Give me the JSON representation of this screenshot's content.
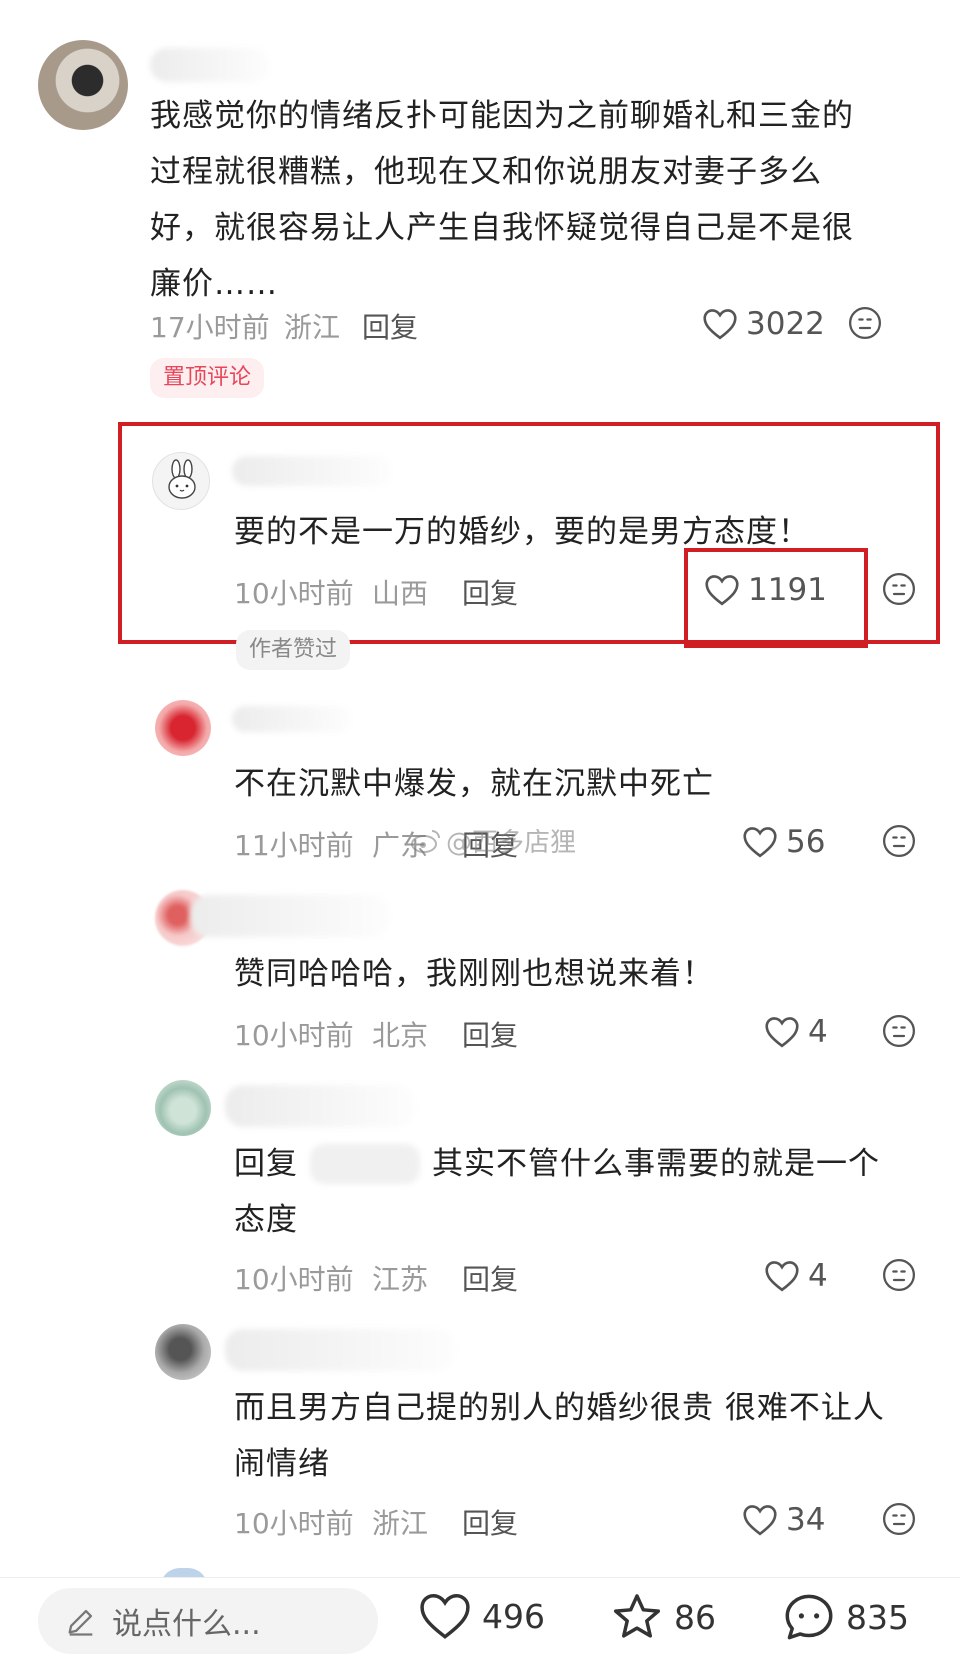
{
  "comments": [
    {
      "text_lines": [
        "我感觉你的情绪反扑可能因为之前聊婚礼和三金的",
        "过程就很糟糕，他现在又和你说朋友对妻子多么",
        "好，就很容易让人产生自我怀疑觉得自己是不是很",
        "廉价……"
      ],
      "time": "17小时前",
      "region": "浙江",
      "reply": "回复",
      "likes": "3022",
      "tag": "置顶评论"
    },
    {
      "text_lines": [
        "要的不是一万的婚纱，要的是男方态度！"
      ],
      "time": "10小时前",
      "region": "山西",
      "reply": "回复",
      "likes": "1191",
      "tag": "作者赞过"
    },
    {
      "text_lines": [
        "不在沉默中爆发，就在沉默中死亡"
      ],
      "time": "11小时前",
      "region": "广东",
      "reply": "回复",
      "likes": "56"
    },
    {
      "text_lines": [
        "赞同哈哈哈，我刚刚也想说来着！"
      ],
      "time": "10小时前",
      "region": "北京",
      "reply": "回复",
      "likes": "4"
    },
    {
      "text_prefix": "回复",
      "text_lines": [
        "其实不管什么事需要的就是一个",
        "态度"
      ],
      "time": "10小时前",
      "region": "江苏",
      "reply": "回复",
      "likes": "4"
    },
    {
      "text_lines": [
        "而且男方自己提的别人的婚纱很贵 很难不让人",
        "闹情绪"
      ],
      "time": "10小时前",
      "region": "浙江",
      "reply": "回复",
      "likes": "34"
    }
  ],
  "watermark": "@西多店狸",
  "bottom_bar": {
    "input_placeholder": "说点什么...",
    "likes": "496",
    "favorites": "86",
    "comments": "835"
  },
  "colors": {
    "highlight_box": "#cf1f25",
    "pinned_tag_text": "#e8465a",
    "pinned_tag_bg": "#fdeef0",
    "meta_text": "#9a9a9a"
  },
  "icons": [
    "heart-icon",
    "emoji-face-icon",
    "bunny-avatar-icon",
    "pencil-icon",
    "star-icon",
    "comment-bubble-icon",
    "weibo-logo-icon"
  ]
}
